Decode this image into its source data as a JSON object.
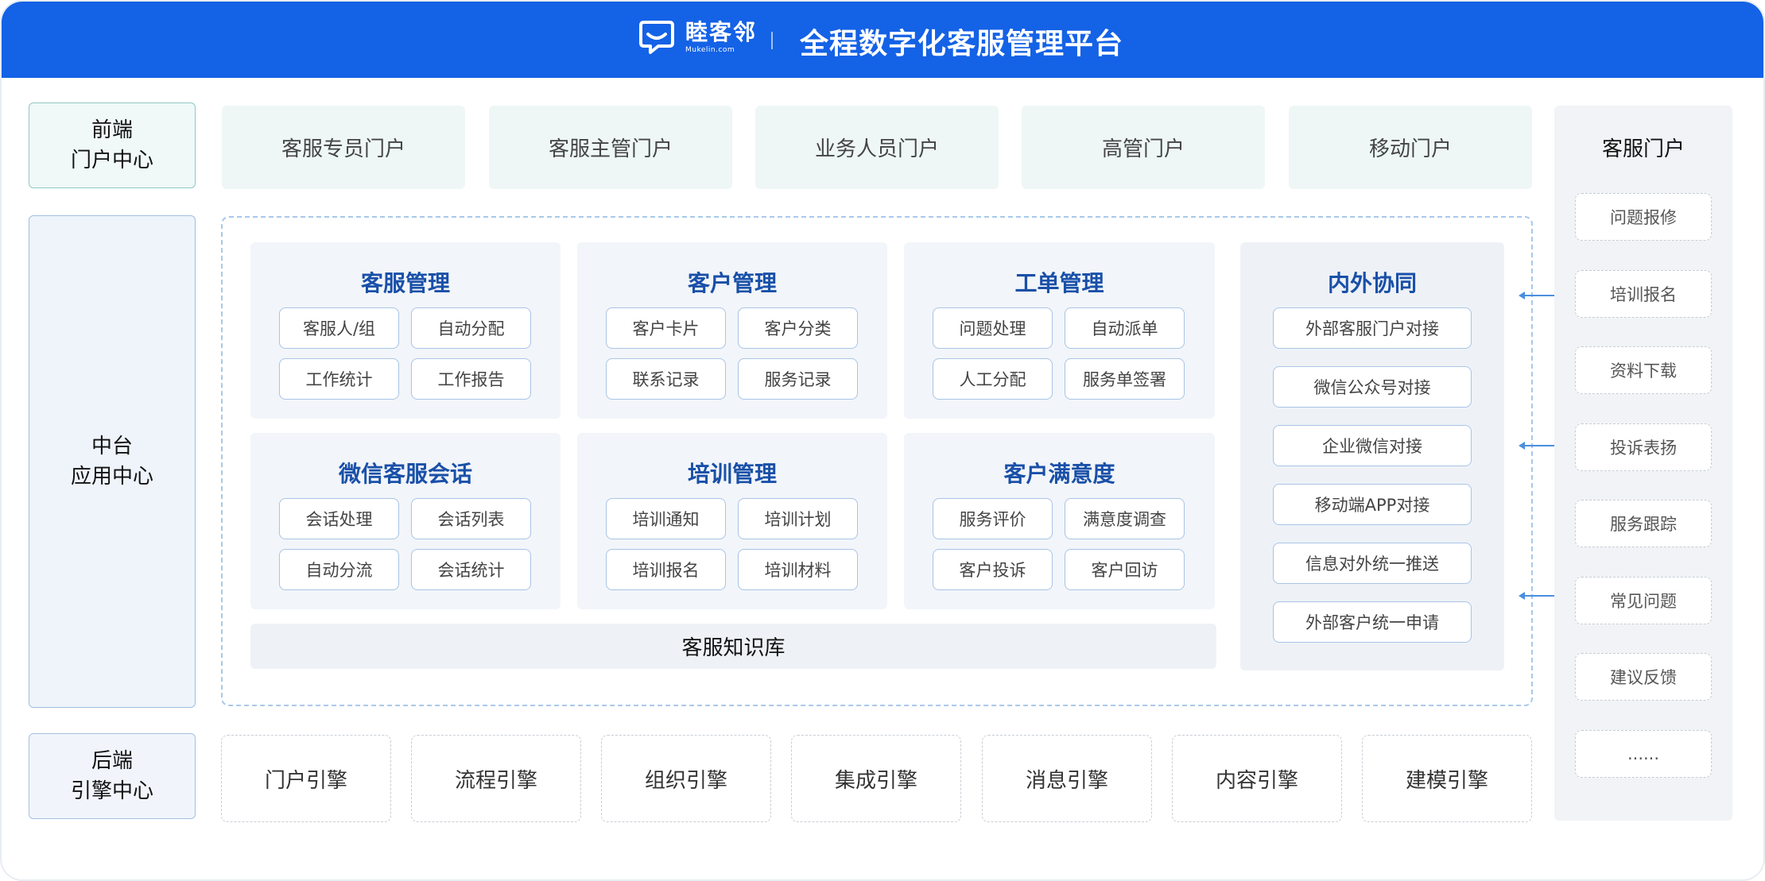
{
  "header": {
    "logo_name": "睦客邻",
    "logo_sub": "Mukelin.com",
    "title": "全程数字化客服管理平台"
  },
  "tiers": {
    "front": [
      "前端",
      "门户中心"
    ],
    "mid": [
      "中台",
      "应用中心"
    ],
    "back": [
      "后端",
      "引擎中心"
    ]
  },
  "portals": [
    "客服专员门户",
    "客服主管门户",
    "业务人员门户",
    "高管门户",
    "移动门户"
  ],
  "modules": [
    {
      "title": "客服管理",
      "items": [
        "客服人/组",
        "自动分配",
        "工作统计",
        "工作报告"
      ]
    },
    {
      "title": "客户管理",
      "items": [
        "客户卡片",
        "客户分类",
        "联系记录",
        "服务记录"
      ]
    },
    {
      "title": "工单管理",
      "items": [
        "问题处理",
        "自动派单",
        "人工分配",
        "服务单签署"
      ]
    },
    {
      "title": "微信客服会话",
      "items": [
        "会话处理",
        "会话列表",
        "自动分流",
        "会话统计"
      ]
    },
    {
      "title": "培训管理",
      "items": [
        "培训通知",
        "培训计划",
        "培训报名",
        "培训材料"
      ]
    },
    {
      "title": "客户满意度",
      "items": [
        "服务评价",
        "满意度调查",
        "客户投诉",
        "客户回访"
      ]
    }
  ],
  "knowledge_base": "客服知识库",
  "collab": {
    "title": "内外协同",
    "items": [
      "外部客服门户对接",
      "微信公众号对接",
      "企业微信对接",
      "移动端APP对接",
      "信息对外统一推送",
      "外部客户统一申请"
    ]
  },
  "customer_portal": {
    "title": "客服门户",
    "items": [
      "问题报修",
      "培训报名",
      "资料下载",
      "投诉表扬",
      "服务跟踪",
      "常见问题",
      "建议反馈",
      "......"
    ]
  },
  "engines": [
    "门户引擎",
    "流程引擎",
    "组织引擎",
    "集成引擎",
    "消息引擎",
    "内容引擎",
    "建模引擎"
  ],
  "colors": {
    "header_bg": "#1462e6",
    "module_title": "#1950a8",
    "chip_border": "#a9c4e6",
    "arrow": "#4a8fe0"
  }
}
